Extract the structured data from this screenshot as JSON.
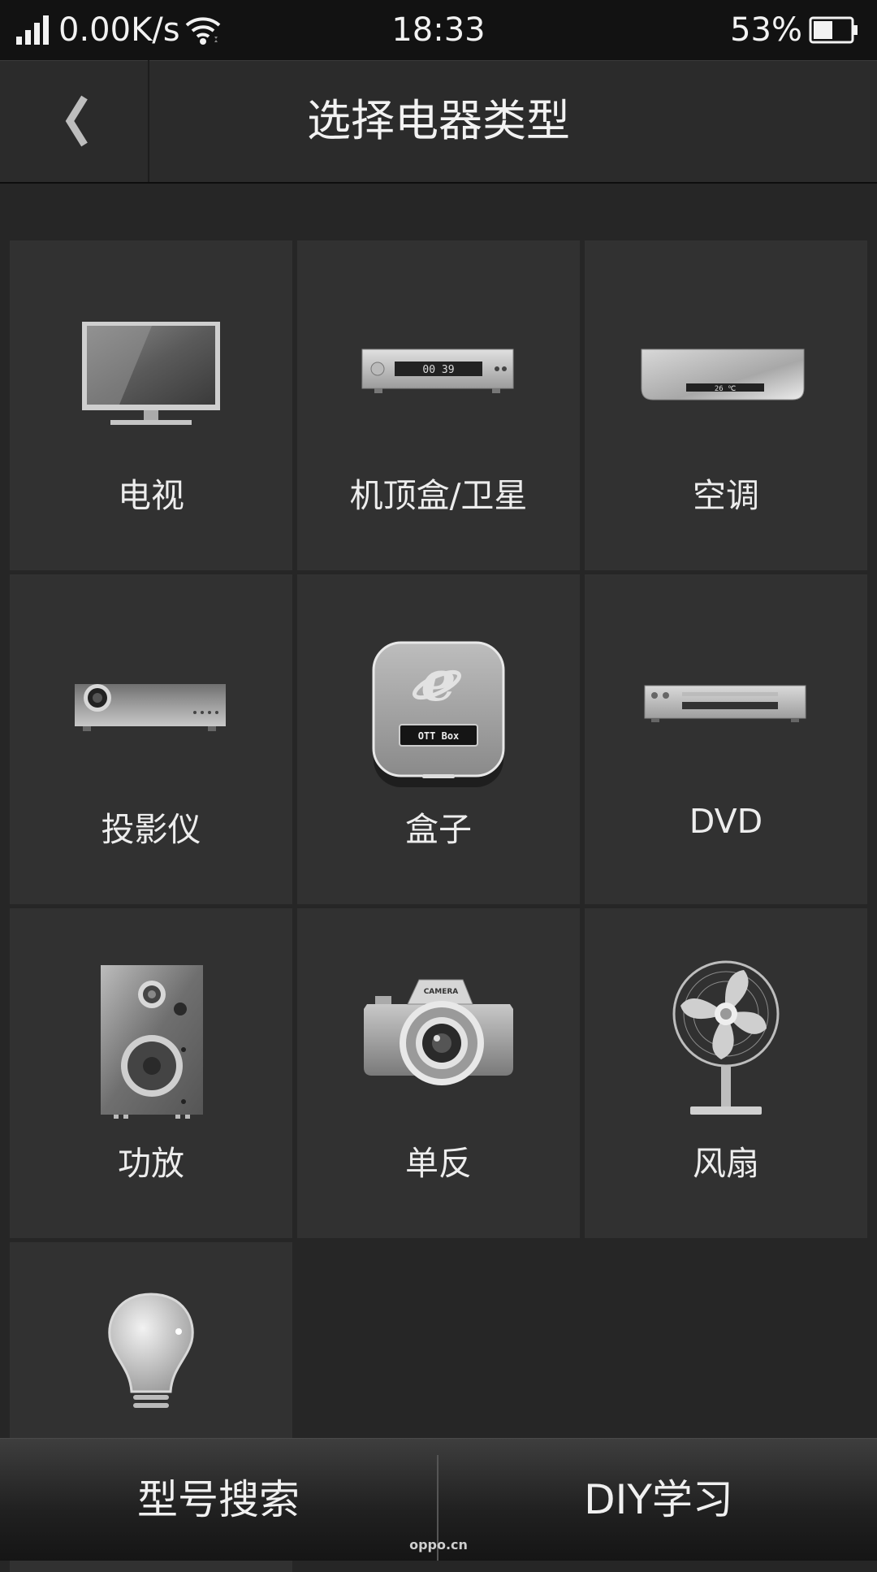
{
  "status_bar": {
    "net_speed": "0.00K/s",
    "time": "18:33",
    "battery_percent": "53%",
    "battery_level": 0.53,
    "icons": [
      "signal-icon",
      "wifi-icon",
      "battery-icon"
    ]
  },
  "header": {
    "title": "选择电器类型",
    "back_icon": "chevron-left-icon"
  },
  "appliances": [
    {
      "label": "电视",
      "icon": "tv-icon"
    },
    {
      "label": "机顶盒/卫星",
      "icon": "set-top-box-icon"
    },
    {
      "label": "空调",
      "icon": "air-conditioner-icon"
    },
    {
      "label": "投影仪",
      "icon": "projector-icon"
    },
    {
      "label": "盒子",
      "icon": "ott-box-icon"
    },
    {
      "label": "DVD",
      "icon": "dvd-player-icon"
    },
    {
      "label": "功放",
      "icon": "speaker-icon"
    },
    {
      "label": "单反",
      "icon": "camera-icon"
    },
    {
      "label": "风扇",
      "icon": "fan-icon"
    },
    {
      "label": "",
      "icon": "light-bulb-icon"
    }
  ],
  "icon_text": {
    "stb_display": "00 39",
    "ac_display": "26 ℃",
    "ott_label": "OTT Box",
    "camera_label": "CAMERA"
  },
  "bottom_bar": {
    "search_label": "型号搜索",
    "diy_label": "DIY学习"
  },
  "watermark": "oppo.cn"
}
